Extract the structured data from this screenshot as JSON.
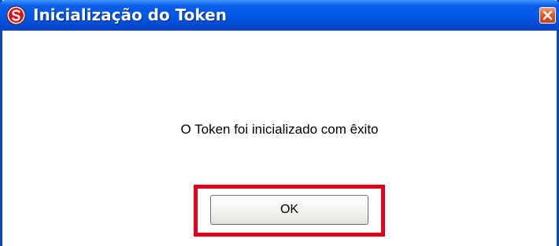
{
  "window": {
    "title": "Inicialização do Token",
    "app_icon": "app-logo-icon",
    "close_icon": "close-icon"
  },
  "dialog": {
    "message": "O Token foi inicializado com êxito",
    "ok_label": "OK"
  },
  "colors": {
    "titlebar": "#0058e6",
    "highlight_border": "#e2001a",
    "close_button": "#e05a2c"
  }
}
